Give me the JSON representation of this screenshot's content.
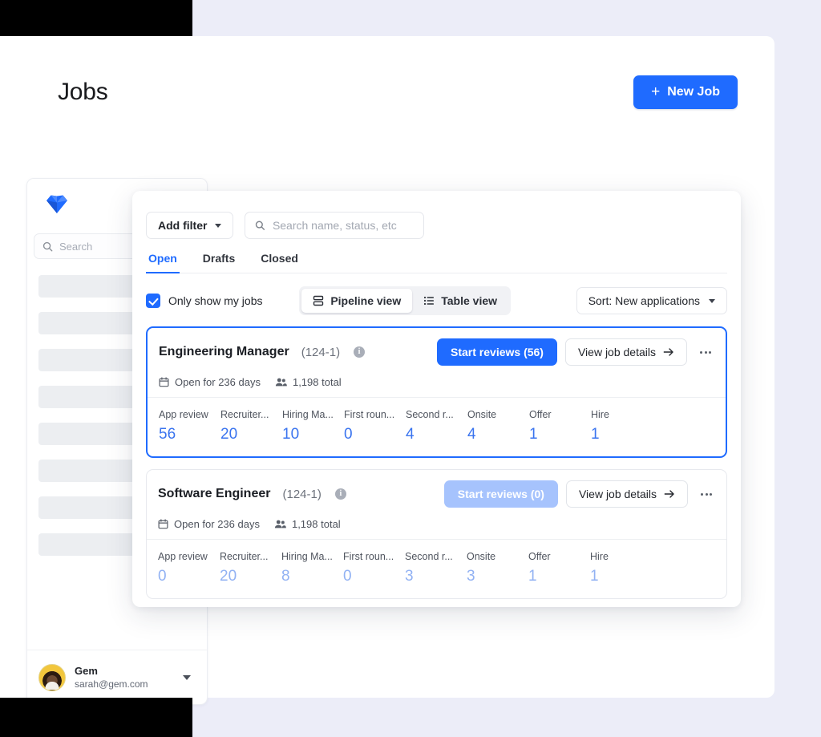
{
  "page": {
    "title": "Jobs",
    "new_job_button": "New Job",
    "new_job_icon": "plus-icon",
    "background_color": "#ecedf8"
  },
  "sidebar": {
    "logo_icon": "gem-diamond-logo",
    "search_placeholder": "Search",
    "search_icon": "search-icon",
    "skeleton_row_count": 8,
    "user": {
      "name": "Gem",
      "email": "sarah@gem.com",
      "avatar_icon": "user-avatar",
      "caret_icon": "chevron-down-icon"
    }
  },
  "panel": {
    "add_filter": {
      "label": "Add filter",
      "caret_icon": "chevron-down-icon"
    },
    "search": {
      "placeholder": "Search name, status, etc",
      "value": "",
      "icon": "search-icon"
    },
    "tabs": [
      {
        "label": "Open",
        "active": true
      },
      {
        "label": "Drafts",
        "active": false
      },
      {
        "label": "Closed",
        "active": false
      }
    ],
    "only_my_jobs": {
      "label": "Only show my jobs",
      "checked": true
    },
    "view_toggle": [
      {
        "label": "Pipeline view",
        "icon": "pipeline-icon",
        "active": true
      },
      {
        "label": "Table view",
        "icon": "table-list-icon",
        "active": false
      }
    ],
    "sort": {
      "label": "Sort: New applications",
      "caret_icon": "chevron-down-icon"
    }
  },
  "accent": {
    "blue": "#1f6bff",
    "value_blue": "#3a74ef",
    "value_blue_muted": "#92b2f3",
    "disabled_blue": "#a6c3fd"
  },
  "jobs": [
    {
      "title": "Engineering Manager",
      "req_id": "(124-1)",
      "info_icon": "info-icon",
      "selected": true,
      "start_reviews_label": "Start reviews (56)",
      "start_reviews_disabled": false,
      "view_details_label": "View job details",
      "details_arrow_icon": "arrow-right-icon",
      "kebab_icon": "more-horizontal-icon",
      "open_days_label": "Open for 236 days",
      "calendar_icon": "calendar-icon",
      "total_label": "1,198 total",
      "people_icon": "people-icon",
      "stages": [
        {
          "label": "App review",
          "value": "56"
        },
        {
          "label": "Recruiter...",
          "value": "20"
        },
        {
          "label": "Hiring Ma...",
          "value": "10"
        },
        {
          "label": "First roun...",
          "value": "0"
        },
        {
          "label": "Second r...",
          "value": "4"
        },
        {
          "label": "Onsite",
          "value": "4"
        },
        {
          "label": "Offer",
          "value": "1"
        },
        {
          "label": "Hire",
          "value": "1"
        }
      ]
    },
    {
      "title": "Software Engineer",
      "req_id": "(124-1)",
      "info_icon": "info-icon",
      "selected": false,
      "start_reviews_label": "Start reviews (0)",
      "start_reviews_disabled": true,
      "view_details_label": "View job details",
      "details_arrow_icon": "arrow-right-icon",
      "kebab_icon": "more-horizontal-icon",
      "open_days_label": "Open for 236 days",
      "calendar_icon": "calendar-icon",
      "total_label": "1,198 total",
      "people_icon": "people-icon",
      "stages": [
        {
          "label": "App review",
          "value": "0"
        },
        {
          "label": "Recruiter...",
          "value": "20"
        },
        {
          "label": "Hiring Ma...",
          "value": "8"
        },
        {
          "label": "First roun...",
          "value": "0"
        },
        {
          "label": "Second r...",
          "value": "3"
        },
        {
          "label": "Onsite",
          "value": "3"
        },
        {
          "label": "Offer",
          "value": "1"
        },
        {
          "label": "Hire",
          "value": "1"
        }
      ]
    }
  ]
}
